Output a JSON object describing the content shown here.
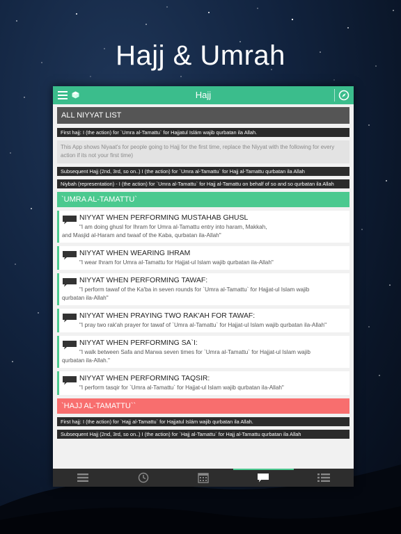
{
  "headline": "Hajj & Umrah",
  "app": {
    "title": "Hajj",
    "accent": "#3bbd8c"
  },
  "sections": {
    "all_niyyat": "ALL NIYYAT LIST",
    "umra": "`UMRA AL-TAMATTU`",
    "hajj": "`HAJJ AL-TAMATTU``"
  },
  "strips": {
    "first_hajj": "First hajj: I (the action) for `Umra al-Tamattu` for Hajjatul Islám wajib qurbatan ila Allah.",
    "subsequent": "Subsequent Hajj (2nd, 3rd, so on..) I (the action) for `Umra al-Tamattu` for Hajj al-Tamattu qurbatan ila Allah",
    "niybah": "Niybah (representation) - I (the action) for `Umra al-Tamattu` for Hajj al-Tamattu on behalf of so and so qurbatan ila Allah",
    "hajj_first": "First hajj: I (the action) for `Hajj al-Tamattu` for Hajjatul Islám wajib qurbatan ila Allah.",
    "hajj_subsequent": "Subsequent Hajj (2nd, 3rd, so on..) I (the action) for `Hajj al-Tamattu` for Hajj al-Tamattu qurbatan ila Allah"
  },
  "note": "This App shows Niyaat's for people going to Hajj for the first time, replace the Niyyat with the following for every action if its not your first time)",
  "cards": [
    {
      "title": "NIYYAT WHEN PERFORMING MUSTAHAB GHUSL",
      "lead": "\"I am doing ghusl for Ihram for Umra al-Tamattu entry into haram, Makkah,",
      "rest": "and Masjid al-Haram and twaaf of the Kaba, qurbatan ila-Allah\""
    },
    {
      "title": "NIYYAT WHEN WEARING IHRAM",
      "lead": "\"I wear Ihram for Umra al-Tamattu for Hajjat-ul Islam wajib qurbatan ila-Allah\"",
      "rest": ""
    },
    {
      "title": "NIYYAT WHEN PERFORMING TAWAF:",
      "lead": "\"I perform tawaf of the Ka'ba in seven rounds for `Umra al-Tamattu` for Hajjat-ul Islam wajib",
      "rest": "qurbatan ila-Allah\""
    },
    {
      "title": "NIYYAT WHEN PRAYING TWO RAK'AH FOR TAWAF:",
      "lead": "\"I pray two rak'ah prayer for tawaf of `Umra al-Tamattu` for Hajjat-ul Islam wajib qurbatan ila-Allah\"",
      "rest": ""
    },
    {
      "title": "NIYYAT WHEN PERFORMING SA`I:",
      "lead": "\"I walk between Safa and Marwa seven times for `Umra al-Tamattu` for Hajjat-ul Islam wajib",
      "rest": "qurbatan ila-Allah.\""
    },
    {
      "title": "NIYYAT WHEN PERFORMING TAQSIR:",
      "lead": "\"I perform tasqir for `Umra al-Tamattu` for Hajjat-ul Islam wajib qurbatan ila-Allah\"",
      "rest": ""
    }
  ],
  "tabs": [
    {
      "icon": "list-icon"
    },
    {
      "icon": "clock-icon"
    },
    {
      "icon": "calendar-icon"
    },
    {
      "icon": "chat-bubble-icon",
      "active": true
    },
    {
      "icon": "bullet-list-icon"
    }
  ]
}
